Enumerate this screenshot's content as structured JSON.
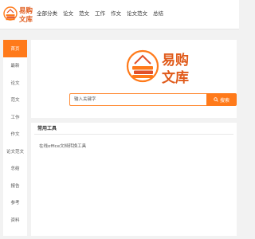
{
  "brand": {
    "name_line1": "易购",
    "name_line2": "文库",
    "accent_color": "#ff7a1a",
    "logo_icon": "stacked-books-icon"
  },
  "top_nav": [
    {
      "label": "全部分类"
    },
    {
      "label": "论文"
    },
    {
      "label": "范文"
    },
    {
      "label": "工作"
    },
    {
      "label": "作文"
    },
    {
      "label": "论文范文"
    },
    {
      "label": "总结"
    }
  ],
  "sidebar": {
    "items": [
      {
        "label": "首页",
        "active": true
      },
      {
        "label": "最新",
        "active": false
      },
      {
        "label": "论文",
        "active": false
      },
      {
        "label": "范文",
        "active": false
      },
      {
        "label": "工作",
        "active": false
      },
      {
        "label": "作文",
        "active": false
      },
      {
        "label": "论文范文",
        "active": false
      },
      {
        "label": "总结",
        "active": false
      },
      {
        "label": "报告",
        "active": false
      },
      {
        "label": "参考",
        "active": false
      },
      {
        "label": "资料",
        "active": false
      }
    ]
  },
  "search": {
    "placeholder": "输入关键字",
    "button_label": "搜索",
    "button_icon": "search-icon"
  },
  "tools": {
    "title": "常用工具",
    "links": [
      {
        "label": "在线office文档转换工具"
      }
    ]
  }
}
